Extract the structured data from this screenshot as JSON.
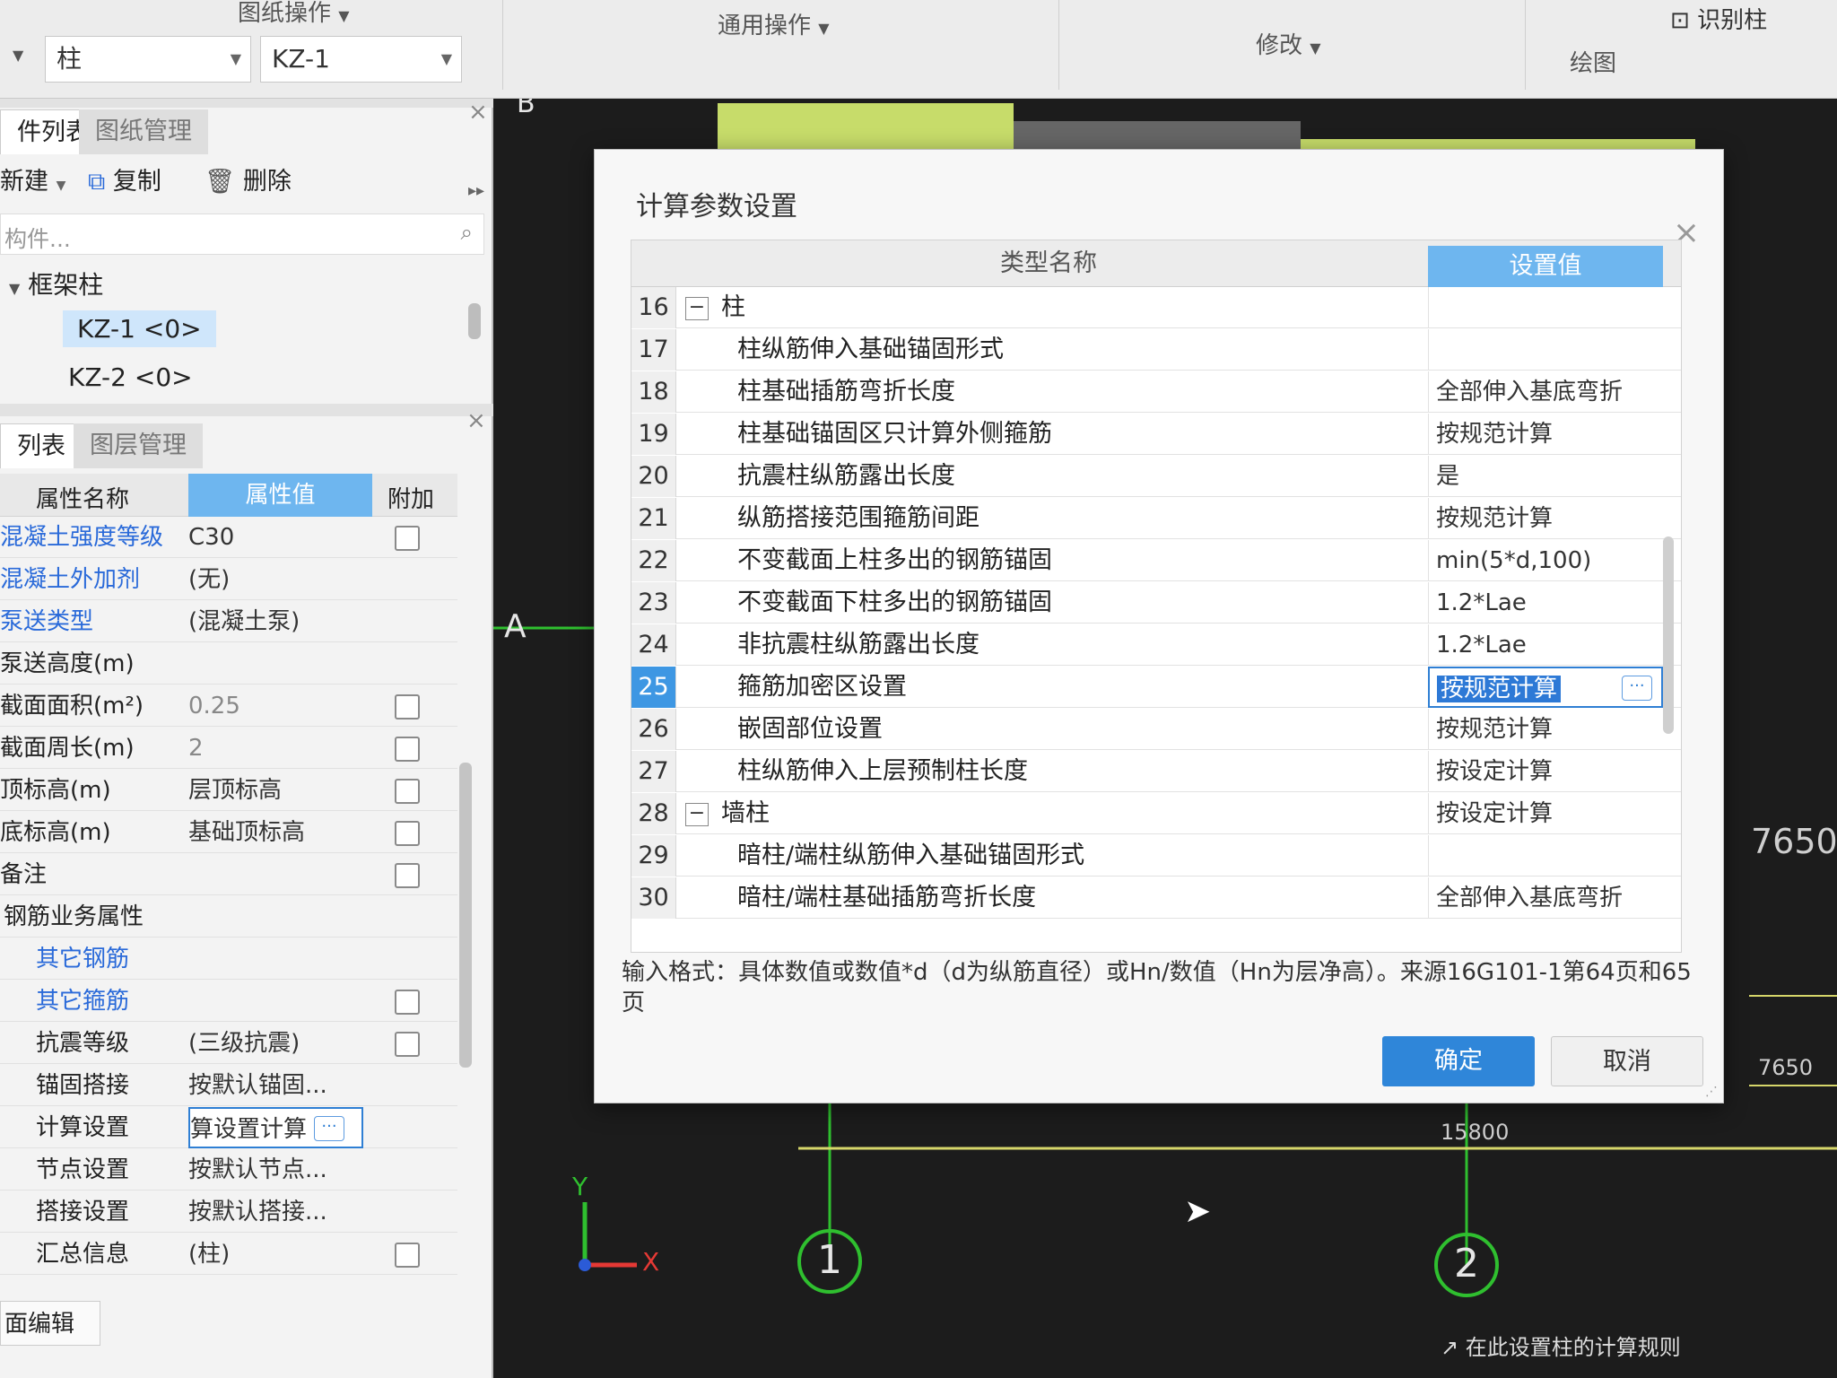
{
  "toolbar": {
    "group1": "图纸操作",
    "group2": "通用操作",
    "group3": "修改",
    "group4": "绘图",
    "identify_column": "识别柱",
    "component_type": "柱",
    "component_name": "KZ-1"
  },
  "component_panel": {
    "tab_active": "件列表",
    "tab_inactive": "图纸管理",
    "new_label": "新建",
    "copy_label": "复制",
    "delete_label": "删除",
    "search_placeholder": "构件...",
    "tree_group": "框架柱",
    "items": [
      "KZ-1 <0>",
      "KZ-2 <0>"
    ]
  },
  "property_panel": {
    "tab_active": "列表",
    "tab_inactive": "图层管理",
    "col_name": "属性名称",
    "col_value": "属性值",
    "col_extra": "附加",
    "rows": [
      {
        "name": "混凝土强度等级",
        "value": "C30"
      },
      {
        "name": "混凝土外加剂",
        "value": "(无)"
      },
      {
        "name": "泵送类型",
        "value": "(混凝土泵)"
      },
      {
        "name": "泵送高度(m)",
        "value": ""
      },
      {
        "name": "截面面积(m²)",
        "value": "0.25"
      },
      {
        "name": "截面周长(m)",
        "value": "2"
      },
      {
        "name": "顶标高(m)",
        "value": "层顶标高"
      },
      {
        "name": "底标高(m)",
        "value": "基础顶标高"
      },
      {
        "name": "备注",
        "value": ""
      },
      {
        "name": "钢筋业务属性",
        "value": ""
      },
      {
        "name": "其它钢筋",
        "value": ""
      },
      {
        "name": "其它箍筋",
        "value": ""
      },
      {
        "name": "抗震等级",
        "value": "(三级抗震)"
      },
      {
        "name": "锚固搭接",
        "value": "按默认锚固..."
      },
      {
        "name": "计算设置",
        "value": "算设置计算"
      },
      {
        "name": "节点设置",
        "value": "按默认节点..."
      },
      {
        "name": "搭接设置",
        "value": "按默认搭接..."
      },
      {
        "name": "汇总信息",
        "value": "(柱)"
      }
    ],
    "bottom_button": "面编辑"
  },
  "canvas": {
    "axis_1": "1",
    "axis_2": "2",
    "axis_A": "A",
    "axis_B": "B",
    "dim_right_1": "7650",
    "dim_right_2": "7650",
    "dim_bottom": "15800",
    "coord_x": "X",
    "coord_y": "Y",
    "status_hint": "在此设置柱的计算规则"
  },
  "dialog": {
    "title": "计算参数设置",
    "col_name": "类型名称",
    "col_value": "设置值",
    "rows": [
      {
        "num": "16",
        "name": "柱",
        "value": "",
        "group": true
      },
      {
        "num": "17",
        "name": "柱纵筋伸入基础锚固形式",
        "value": ""
      },
      {
        "num": "18",
        "name": "柱基础插筋弯折长度",
        "value": "全部伸入基底弯折"
      },
      {
        "num": "19",
        "name": "柱基础锚固区只计算外侧箍筋",
        "value": "按规范计算"
      },
      {
        "num": "20",
        "name": "抗震柱纵筋露出长度",
        "value": "是"
      },
      {
        "num": "21",
        "name": "纵筋搭接范围箍筋间距",
        "value": "按规范计算"
      },
      {
        "num": "22",
        "name": "不变截面上柱多出的钢筋锚固",
        "value": "min(5*d,100)"
      },
      {
        "num": "23",
        "name": "不变截面下柱多出的钢筋锚固",
        "value": "1.2*Lae"
      },
      {
        "num": "24",
        "name": "非抗震柱纵筋露出长度",
        "value": "1.2*Lae"
      },
      {
        "num": "25",
        "name": "箍筋加密区设置",
        "value": "按规范计算",
        "selected": true
      },
      {
        "num": "26",
        "name": "嵌固部位设置",
        "value": "按规范计算"
      },
      {
        "num": "27",
        "name": "柱纵筋伸入上层预制柱长度",
        "value": "按设定计算"
      },
      {
        "num": "28",
        "name": "墙柱",
        "value": "按设定计算",
        "group": true
      },
      {
        "num": "29",
        "name": "暗柱/端柱纵筋伸入基础锚固形式",
        "value": ""
      },
      {
        "num": "30",
        "name": "暗柱/端柱基础插筋弯折长度",
        "value": "全部伸入基底弯折"
      }
    ],
    "hint": "输入格式：具体数值或数值*d（d为纵筋直径）或Hn/数值（Hn为层净高）。来源16G101-1第64页和65页",
    "ok": "确定",
    "cancel": "取消"
  }
}
